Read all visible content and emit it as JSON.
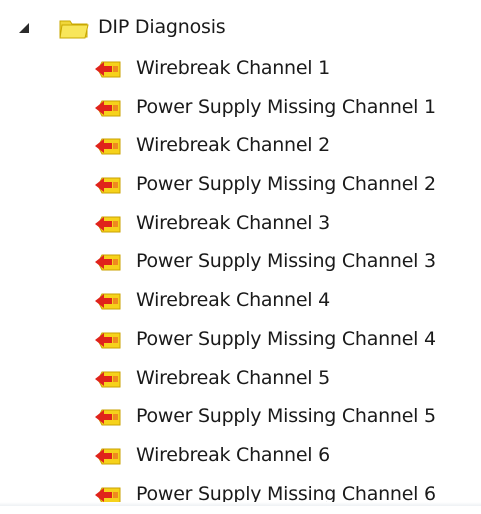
{
  "tree": {
    "root": {
      "label": "DIP Diagnosis",
      "expanded": true,
      "icon": "folder-icon"
    },
    "children": [
      {
        "label": "Wirebreak Channel 1",
        "icon": "diagnostic-tag-icon"
      },
      {
        "label": "Power Supply Missing Channel 1",
        "icon": "diagnostic-tag-icon"
      },
      {
        "label": "Wirebreak Channel 2",
        "icon": "diagnostic-tag-icon"
      },
      {
        "label": "Power Supply Missing Channel 2",
        "icon": "diagnostic-tag-icon"
      },
      {
        "label": "Wirebreak Channel 3",
        "icon": "diagnostic-tag-icon"
      },
      {
        "label": "Power Supply Missing Channel 3",
        "icon": "diagnostic-tag-icon"
      },
      {
        "label": "Wirebreak Channel 4",
        "icon": "diagnostic-tag-icon"
      },
      {
        "label": "Power Supply Missing Channel 4",
        "icon": "diagnostic-tag-icon"
      },
      {
        "label": "Wirebreak Channel 5",
        "icon": "diagnostic-tag-icon"
      },
      {
        "label": "Power Supply Missing Channel 5",
        "icon": "diagnostic-tag-icon"
      },
      {
        "label": "Wirebreak Channel 6",
        "icon": "diagnostic-tag-icon"
      },
      {
        "label": "Power Supply Missing Channel 6",
        "icon": "diagnostic-tag-icon"
      }
    ]
  },
  "colors": {
    "folder_fill": "#f5e04a",
    "folder_stroke": "#c9a800",
    "tag_yellow": "#f6d21b",
    "tag_red": "#e0231b",
    "tag_orange": "#ef8a1f",
    "text": "#1a1a1a",
    "toggle": "#2b2b2b"
  }
}
